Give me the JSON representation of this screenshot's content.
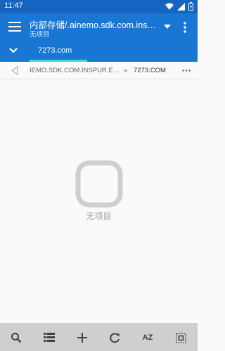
{
  "status_bar": {
    "time": "11:47"
  },
  "app_bar": {
    "path_title": "内部存储/.ainemo.sdk.com.inspur....",
    "path_subtitle": "无项目"
  },
  "tabs": [
    {
      "label": "7273.com",
      "active": true
    }
  ],
  "breadcrumb": {
    "items": [
      "IEMO.SDK.COM.INSPUR.EM...",
      "7273.COM"
    ],
    "separator": "»"
  },
  "empty_state": {
    "message": "无项目"
  },
  "bottom_bar": {
    "sort_label": "AZ"
  },
  "colors": {
    "status_bar": "#1565c0",
    "app_bar": "#1976d2",
    "tab_indicator": "#4dd0e1",
    "bottom_bar": "#cfcfcf"
  }
}
